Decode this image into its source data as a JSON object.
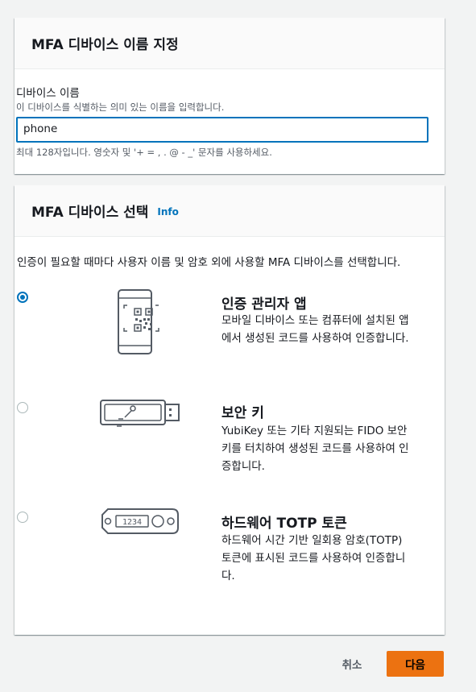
{
  "name_panel": {
    "title": "MFA 디바이스 이름 지정",
    "label": "디바이스 이름",
    "description": "이 디바이스를 식별하는 의미 있는 이름을 입력합니다.",
    "input_value": "phone",
    "constraint": "최대 128자입니다. 영숫자 및 '+ = , . @ - _' 문자를 사용하세요."
  },
  "select_panel": {
    "title": "MFA 디바이스 선택",
    "info": "Info",
    "intro": "인증이 필요할 때마다 사용자 이름 및 암호 외에 사용할 MFA 디바이스를 선택합니다.",
    "options": [
      {
        "title": "인증 관리자 앱",
        "description": "모바일 디바이스 또는 컴퓨터에 설치된 앱에서 생성된 코드를 사용하여 인증합니다.",
        "selected": true,
        "icon": "authenticator-app-qr-phone-icon"
      },
      {
        "title": "보안 키",
        "description": "YubiKey 또는 기타 지원되는 FIDO 보안 키를 터치하여 생성된 코드를 사용하여 인증합니다.",
        "selected": false,
        "icon": "usb-security-key-icon"
      },
      {
        "title": "하드웨어 TOTP 토큰",
        "description": "하드웨어 시간 기반 일회용 암호(TOTP) 토큰에 표시된 코드를 사용하여 인증합니다.",
        "selected": false,
        "icon": "hardware-token-icon",
        "token_display": "1234"
      }
    ]
  },
  "footer": {
    "cancel_label": "취소",
    "next_label": "다음"
  },
  "colors": {
    "accent": "#0073bb",
    "primary_button": "#ec7211",
    "background": "#f2f3f3",
    "icon_stroke": "#545b64"
  }
}
